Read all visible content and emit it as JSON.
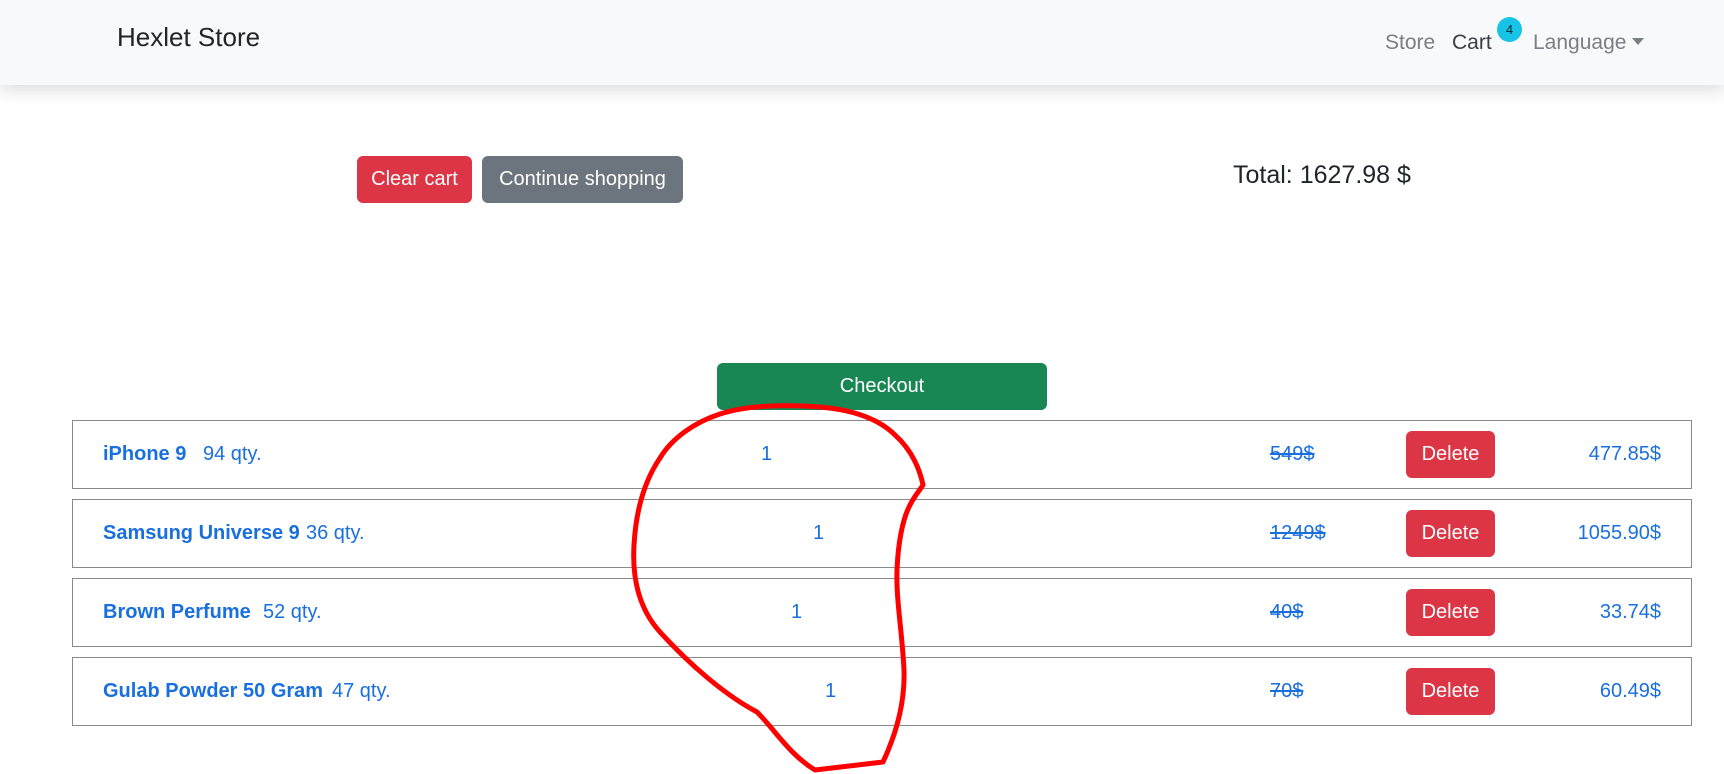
{
  "navbar": {
    "brand": "Hexlet Store",
    "links": {
      "store": "Store",
      "cart": "Cart",
      "language": "Language"
    },
    "cart_badge": "4"
  },
  "actions": {
    "clear_cart": "Clear cart",
    "continue_shopping": "Continue shopping",
    "checkout": "Checkout"
  },
  "total": "Total: 1627.98 $",
  "cart_items": [
    {
      "name": "iPhone 9",
      "stock": "94 qty.",
      "count": "1",
      "old_price": "549$",
      "delete_label": "Delete",
      "final_price": "477.85$"
    },
    {
      "name": "Samsung Universe 9",
      "stock": "36 qty.",
      "count": "1",
      "old_price": "1249$",
      "delete_label": "Delete",
      "final_price": "1055.90$"
    },
    {
      "name": "Brown Perfume",
      "stock": "52 qty.",
      "count": "1",
      "old_price": "40$",
      "delete_label": "Delete",
      "final_price": "33.74$"
    },
    {
      "name": "Gulab Powder 50 Gram",
      "stock": "47 qty.",
      "count": "1",
      "old_price": "70$",
      "delete_label": "Delete",
      "final_price": "60.49$"
    }
  ],
  "colors": {
    "primary_link": "#1a6fde",
    "danger": "#dc3545",
    "secondary": "#6c757d",
    "success": "#198754",
    "badge": "#17c4e8",
    "annotation": "#ff0000"
  }
}
